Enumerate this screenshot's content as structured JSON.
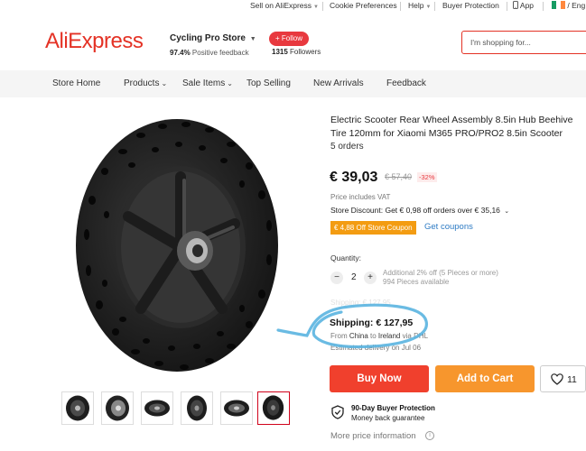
{
  "topbar": {
    "sell": "Sell on AliExpress",
    "cookie": "Cookie Preferences",
    "help": "Help",
    "protection": "Buyer Protection",
    "app": "App",
    "lang": "/ Eng"
  },
  "header": {
    "logo": "AliExpress",
    "store_name": "Cycling Pro Store",
    "feedback_pct": "97.4%",
    "feedback_label": "Positive feedback",
    "follow": "+ Follow",
    "followers_count": "1315",
    "followers_label": "Followers",
    "search_placeholder": "I'm shopping for..."
  },
  "nav": [
    "Store Home",
    "Products",
    "Sale Items",
    "Top Selling",
    "New Arrivals",
    "Feedback"
  ],
  "product": {
    "title": "Electric Scooter Rear Wheel Assembly 8.5in Hub Beehive Tire 120mm for Xiaomi M365 PRO/PRO2 8.5in Scooter",
    "orders": "5 orders",
    "price": "€ 39,03",
    "old_price": "€ 57,40",
    "discount": "-32%",
    "vat": "Price includes VAT",
    "store_discount": "Store Discount: Get € 0,98 off orders over € 35,16",
    "coupon": "€ 4,88 Off Store Coupon",
    "get_coupons": "Get coupons",
    "quantity_label": "Quantity:",
    "quantity": "2",
    "qty_note_1": "Additional 2% off (5 Pieces or more)",
    "qty_note_2": "994 Pieces available",
    "shipping_faded": "Shipping: € 127,95",
    "shipping": "Shipping: € 127,95",
    "ship_from_1": "From ",
    "ship_origin": "China",
    "ship_from_2": " to ",
    "ship_dest": "Ireland",
    "ship_from_3": " via DHL",
    "ship_est": "Estimated delivery on Jul 06",
    "buy_now": "Buy Now",
    "add_to_cart": "Add to Cart",
    "wishlist_count": "11",
    "protection_title": "90-Day Buyer Protection",
    "protection_sub": "Money back guarantee",
    "more_price": "More price information"
  },
  "colors": {
    "brand": "#e43225",
    "buy_now": "#f0402d",
    "add_to_cart": "#f7962d",
    "coupon": "#f39c12",
    "link": "#2e7bc4",
    "annotation": "#5ab4e0"
  },
  "icons": [
    "heart-icon",
    "shield-check-icon",
    "info-icon",
    "phone-icon",
    "ireland-flag-icon"
  ]
}
